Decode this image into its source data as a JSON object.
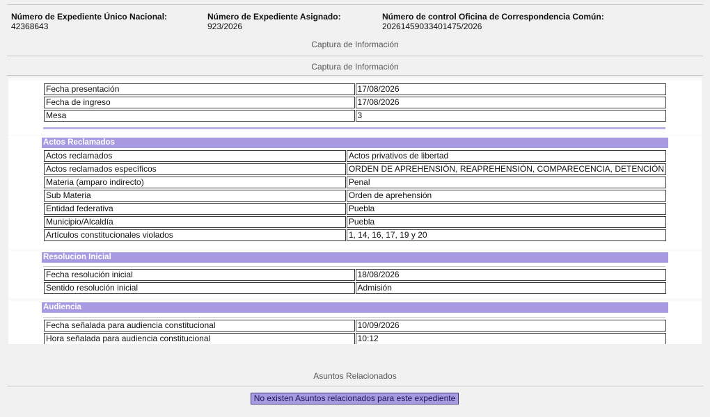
{
  "header": {
    "expediente_unico_label": "Número de Expediente Único Nacional:",
    "expediente_unico_value": "42368643",
    "expediente_asignado_label": "Número de Expediente Asignado:",
    "expediente_asignado_value": "923/2026",
    "control_oficina_label": "Número de control Oficina de Correspondencia Común:",
    "control_oficina_value": "20261459033401475/2026"
  },
  "captura_1": "Captura de Información",
  "captura_2": "Captura de Información",
  "general": [
    {
      "label": "Fecha presentación",
      "value": "17/08/2026"
    },
    {
      "label": "Fecha de ingreso",
      "value": "17/08/2026"
    },
    {
      "label": "Mesa",
      "value": "3"
    }
  ],
  "actos": {
    "title": "Actos Reclamados",
    "rows": [
      {
        "label": "Actos reclamados",
        "value": "Actos privativos de libertad"
      },
      {
        "label": "Actos reclamados específicos",
        "value": "ORDEN DE APREHENSIÓN, REAPREHENSIÓN, COMPARECENCIA, DETENCIÓN"
      },
      {
        "label": "Materia (amparo indirecto)",
        "value": "Penal"
      },
      {
        "label": "Sub Materia",
        "value": "Orden de aprehensión"
      },
      {
        "label": "Entidad federativa",
        "value": "Puebla"
      },
      {
        "label": "Municipio/Alcaldía",
        "value": "Puebla"
      },
      {
        "label": "Artículos constitucionales violados",
        "value": "1, 14, 16, 17, 19 y 20"
      }
    ]
  },
  "resolucion": {
    "title": "Resolucion Inicial",
    "rows": [
      {
        "label": "Fecha resolución inicial",
        "value": "18/08/2026"
      },
      {
        "label": "Sentido resolución inicial",
        "value": "Admisión"
      }
    ]
  },
  "audiencia": {
    "title": "Audiencia",
    "rows": [
      {
        "label": "Fecha señalada para audiencia constitucional",
        "value": "10/09/2026"
      },
      {
        "label": "Hora señalada para audiencia constitucional",
        "value": "10:12"
      }
    ]
  },
  "asuntos": {
    "title": "Asuntos Relacionados",
    "empty_message": "No existen Asuntos relacionados para este expediente"
  }
}
